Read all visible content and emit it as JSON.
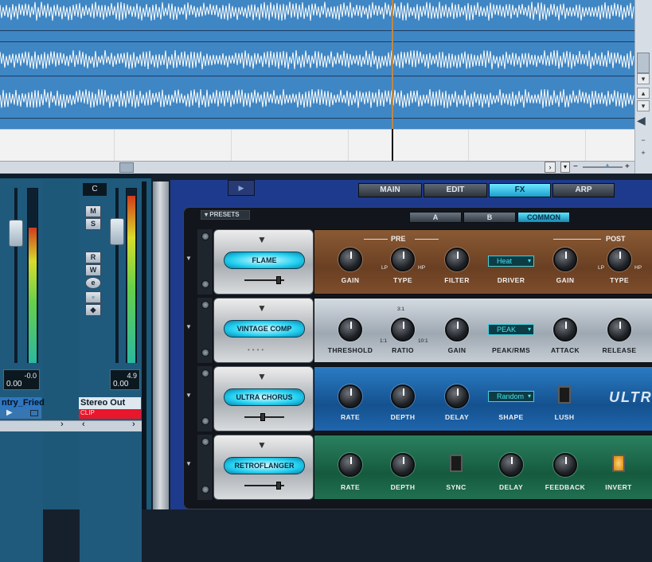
{
  "mixer": {
    "channel1": {
      "peak": "-0.0",
      "value": "0.00",
      "name": "ntry_Fried"
    },
    "channel2": {
      "label": "C",
      "peak": "4.9",
      "value": "0.00",
      "name": "Stereo Out",
      "clip": "CLIP"
    },
    "buttons": [
      "M",
      "S",
      "R",
      "W",
      "e"
    ]
  },
  "instrument": {
    "tabs": [
      "MAIN",
      "EDIT",
      "FX",
      "ARP"
    ],
    "active_tab": "FX",
    "presets_label": "PRESETS",
    "sub_tabs": [
      "A",
      "B",
      "COMMON"
    ],
    "active_sub_tab": "COMMON",
    "effects": [
      {
        "name": "FLAME",
        "section_pre": "PRE",
        "section_post": "POST",
        "controls": [
          "GAIN",
          "TYPE",
          "FILTER",
          "DRIVER",
          "GAIN",
          "TYPE"
        ],
        "small_labels": [
          "LP",
          "HP",
          "LP",
          "HP"
        ],
        "dropdown": "Heat"
      },
      {
        "name": "VINTAGE COMP",
        "controls": [
          "THRESHOLD",
          "RATIO",
          "GAIN",
          "PEAK/RMS",
          "ATTACK",
          "RELEASE"
        ],
        "small_labels": [
          "3:1",
          "1:1",
          "10:1"
        ],
        "dropdown": "PEAK"
      },
      {
        "name": "ULTRA CHORUS",
        "controls": [
          "RATE",
          "DEPTH",
          "DELAY",
          "SHAPE",
          "LUSH"
        ],
        "dropdown": "Random",
        "brand": "ULTR"
      },
      {
        "name": "RETROFLANGER",
        "controls": [
          "RATE",
          "DEPTH",
          "SYNC",
          "DELAY",
          "FEEDBACK",
          "INVERT"
        ]
      }
    ]
  },
  "colors": {
    "wave_bg": "#3f86c4",
    "accent_cyan": "#22d0f0",
    "flame_panel": "#7a4a2a",
    "comp_panel": "#b8c0c8",
    "chorus_panel": "#1d5fa6",
    "flanger_panel": "#1e6a4c"
  }
}
